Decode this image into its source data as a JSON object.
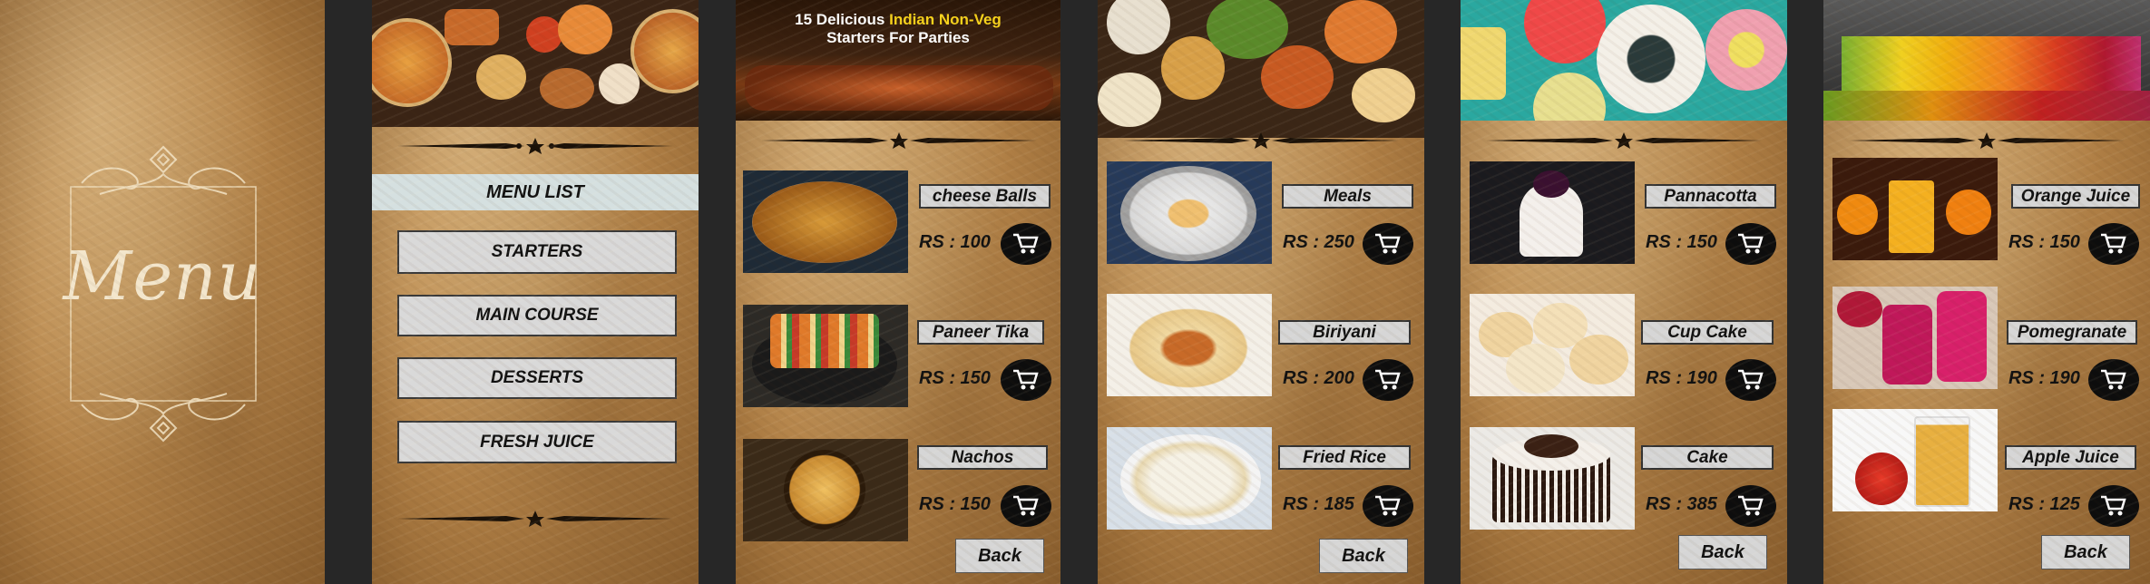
{
  "splash": {
    "title": "Menu"
  },
  "menu_list": {
    "heading": "MENU LIST",
    "buttons": [
      "STARTERS",
      "MAIN COURSE",
      "DESSERTS",
      "FRESH JUICE"
    ]
  },
  "starters": {
    "banner_pre": "15 Delicious ",
    "banner_highlight": "Indian Non-Veg",
    "banner_line2": "Starters For Parties",
    "items": [
      {
        "name": "cheese Balls",
        "price": "RS : 100"
      },
      {
        "name": "Paneer Tika",
        "price": "RS : 150"
      },
      {
        "name": "Nachos",
        "price": "RS : 150"
      }
    ],
    "back": "Back"
  },
  "main_course": {
    "items": [
      {
        "name": "Meals",
        "price": "RS : 250"
      },
      {
        "name": "Biriyani",
        "price": "RS : 200"
      },
      {
        "name": "Fried Rice",
        "price": "RS : 185"
      }
    ],
    "back": "Back"
  },
  "desserts": {
    "items": [
      {
        "name": "Pannacotta",
        "price": "RS : 150"
      },
      {
        "name": "Cup Cake",
        "price": "RS : 190"
      },
      {
        "name": "Cake",
        "price": "RS : 385"
      }
    ],
    "back": "Back"
  },
  "juices": {
    "items": [
      {
        "name": "Orange Juice",
        "price": "RS : 150"
      },
      {
        "name": "Pomegranate",
        "price": "RS : 190"
      },
      {
        "name": "Apple Juice",
        "price": "RS : 125"
      }
    ],
    "back": "Back"
  },
  "icons": {
    "cart": "shopping-cart-icon",
    "divider": "ornament-divider-icon"
  },
  "colors": {
    "parchment": "#b8864a",
    "button": "#d9d9d9",
    "heading_bar": "#d5e0e0",
    "highlight": "#f7d21b",
    "cart_bg": "#0d0d0d"
  }
}
